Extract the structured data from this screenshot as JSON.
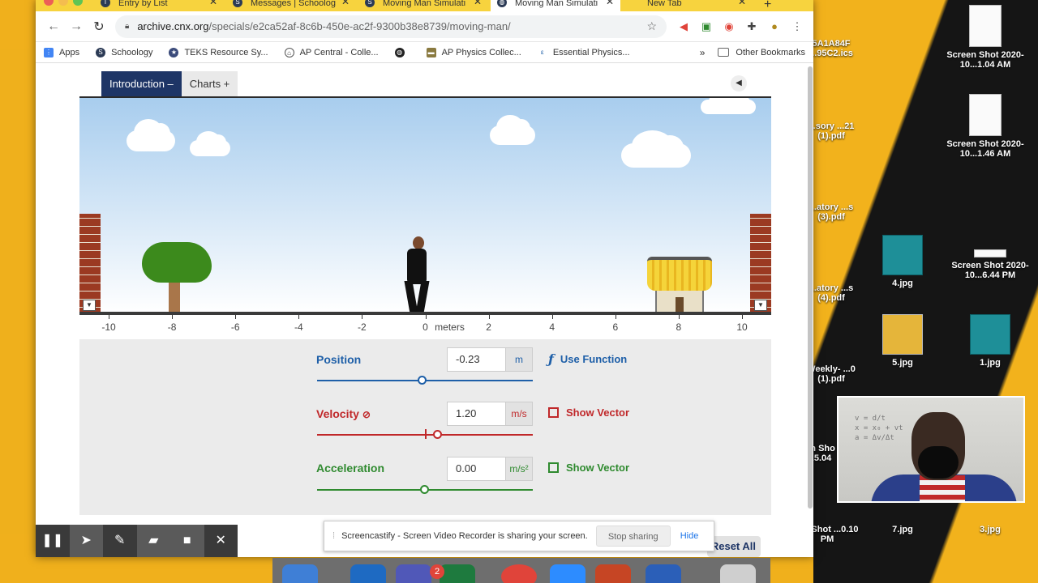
{
  "tabs": [
    {
      "label": "Entry by List",
      "icon": "TAC",
      "active": false
    },
    {
      "label": "Messages | Schoolog",
      "icon": "S",
      "active": false
    },
    {
      "label": "Moving Man Simulati",
      "icon": "S",
      "active": false
    },
    {
      "label": "Moving Man Simulati",
      "icon": "globe",
      "active": true
    },
    {
      "label": "New Tab",
      "icon": "",
      "active": false
    }
  ],
  "url": {
    "host": "archive.cnx.org",
    "path": "/specials/e2ca52af-8c6b-450e-ac2f-9300b38e8739/moving-man/"
  },
  "bookmarks": [
    {
      "label": "Apps",
      "icon": "apps-grid-icon"
    },
    {
      "label": "Schoology",
      "icon": "schoology-icon"
    },
    {
      "label": "TEKS Resource Sy...",
      "icon": "teks-icon"
    },
    {
      "label": "AP Central - Colle...",
      "icon": "ap-central-icon"
    },
    {
      "label": "",
      "icon": "globe-icon"
    },
    {
      "label": "AP Physics Collec...",
      "icon": "ap-physics-icon"
    },
    {
      "label": "Essential Physics...",
      "icon": "essential-physics-icon"
    }
  ],
  "bookmarks_more": "»",
  "other_bookmarks": "Other Bookmarks",
  "sim": {
    "tab_intro": "Introduction –",
    "tab_charts": "Charts +",
    "position": {
      "label": "Position",
      "value": "-0.23",
      "unit": "m",
      "fraction": 0.49
    },
    "velocity": {
      "label": "Velocity",
      "value": "1.20",
      "unit": "m/s",
      "fraction": 0.56
    },
    "acceleration": {
      "label": "Acceleration",
      "value": "0.00",
      "unit": "m/s²",
      "fraction": 0.5
    },
    "use_function": "Use Function",
    "show_vector": "Show Vector",
    "ruler_ticks": [
      "-10",
      "-8",
      "-6",
      "-4",
      "-2",
      "0",
      "2",
      "4",
      "6",
      "8",
      "10"
    ],
    "ruler_unit": "meters",
    "reset": "Reset All"
  },
  "share_bar": {
    "message": "Screencastify - Screen Video Recorder is sharing your screen.",
    "stop": "Stop sharing",
    "hide": "Hide"
  },
  "desktop_icons": [
    {
      "label": "Screen Shot 2020-10...1.04 AM"
    },
    {
      "label": "5A1A84F ...95C2.ics"
    },
    {
      "label": "Screen Shot 2020-10...1.46 AM"
    },
    {
      "label": "...sory ...21 (1).pdf"
    },
    {
      "label": "...atory ...s (3).pdf"
    },
    {
      "label": "4.jpg"
    },
    {
      "label": "Screen Shot 2020-10...6.44 PM"
    },
    {
      "label": "...atory ...s (4).pdf"
    },
    {
      "label": "5.jpg"
    },
    {
      "label": "1.jpg"
    },
    {
      "label": "Weekly- ...0 (1).pdf"
    },
    {
      "label": "...n Sho ...5.04"
    },
    {
      "label": "...n Shot ...0.10 PM"
    },
    {
      "label": "7.jpg"
    },
    {
      "label": "3.jpg"
    }
  ],
  "dock_badge": "2",
  "colors": {
    "position": "#1e5fa8",
    "velocity": "#c0282a",
    "acceleration": "#2f8a2f",
    "tab_active": "#1e3566"
  }
}
